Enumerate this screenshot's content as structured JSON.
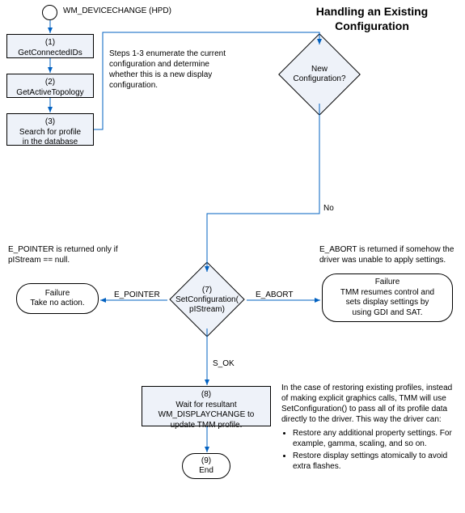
{
  "title": "Handling an Existing Configuration",
  "start_event": "WM_DEVICECHANGE (HPD)",
  "steps": {
    "s1": {
      "num": "(1)",
      "label": "GetConnectedIDs"
    },
    "s2": {
      "num": "(2)",
      "label": "GetActiveTopology"
    },
    "s3": {
      "num": "(3)",
      "label": "Search for profile\nin the database"
    },
    "s7": {
      "num": "(7)",
      "label": "SetConfiguration(\npIStream)"
    },
    "s8": {
      "num": "(8)",
      "label": "Wait for resultant\nWM_DISPLAYCHANGE to\nupdate TMM profile."
    },
    "s9": {
      "num": "(9)",
      "label": "End"
    }
  },
  "decisions": {
    "new_config": "New\nConfiguration?"
  },
  "terminals": {
    "failure_left": "Failure\nTake no action.",
    "failure_right": "Failure\nTMM resumes control and\nsets display settings by\nusing GDI and SAT."
  },
  "edge_labels": {
    "no": "No",
    "e_pointer": "E_POINTER",
    "e_abort": "E_ABORT",
    "s_ok": "S_OK"
  },
  "annotations": {
    "enum_note": "Steps 1-3 enumerate the current configuration and determine whether this is a new display configuration.",
    "epointer_note": "E_POINTER is returned only if pIStream == null.",
    "eabort_note": "E_ABORT is returned if somehow the driver was unable to apply settings.",
    "restore_intro": "In the case of restoring existing profiles, instead of making explicit graphics calls, TMM will use SetConfiguration() to pass all of its profile data directly to the driver. This way the driver can:",
    "restore_b1": "Restore any additional property settings. For example, gamma, scaling, and so on.",
    "restore_b2": "Restore display settings atomically to avoid extra flashes."
  },
  "chart_data": {
    "type": "diagram",
    "kind": "flowchart",
    "title": "Handling an Existing Configuration",
    "nodes": [
      {
        "id": "start",
        "type": "event",
        "label": "WM_DEVICECHANGE (HPD)"
      },
      {
        "id": "n1",
        "type": "process",
        "label": "(1) GetConnectedIDs"
      },
      {
        "id": "n2",
        "type": "process",
        "label": "(2) GetActiveTopology"
      },
      {
        "id": "n3",
        "type": "process",
        "label": "(3) Search for profile in the database"
      },
      {
        "id": "d1",
        "type": "decision",
        "label": "New Configuration?"
      },
      {
        "id": "n7",
        "type": "decision",
        "label": "(7) SetConfiguration(pIStream)"
      },
      {
        "id": "t_left",
        "type": "terminal",
        "label": "Failure – Take no action."
      },
      {
        "id": "t_right",
        "type": "terminal",
        "label": "Failure – TMM resumes control and sets display settings by using GDI and SAT."
      },
      {
        "id": "n8",
        "type": "process",
        "label": "(8) Wait for resultant WM_DISPLAYCHANGE to update TMM profile."
      },
      {
        "id": "n9",
        "type": "terminal",
        "label": "(9) End"
      }
    ],
    "edges": [
      {
        "from": "start",
        "to": "n1"
      },
      {
        "from": "n1",
        "to": "n2"
      },
      {
        "from": "n2",
        "to": "n3"
      },
      {
        "from": "n3",
        "to": "d1"
      },
      {
        "from": "d1",
        "to": "n7",
        "label": "No"
      },
      {
        "from": "n7",
        "to": "t_left",
        "label": "E_POINTER"
      },
      {
        "from": "n7",
        "to": "t_right",
        "label": "E_ABORT"
      },
      {
        "from": "n7",
        "to": "n8",
        "label": "S_OK"
      },
      {
        "from": "n8",
        "to": "n9"
      }
    ],
    "annotations": [
      "Steps 1-3 enumerate the current configuration and determine whether this is a new display configuration.",
      "E_POINTER is returned only if pIStream == null.",
      "E_ABORT is returned if somehow the driver was unable to apply settings.",
      "In the case of restoring existing profiles, instead of making explicit graphics calls, TMM will use SetConfiguration() to pass all of its profile data directly to the driver. This way the driver can: Restore any additional property settings. For example, gamma, scaling, and so on. Restore display settings atomically to avoid extra flashes."
    ]
  }
}
